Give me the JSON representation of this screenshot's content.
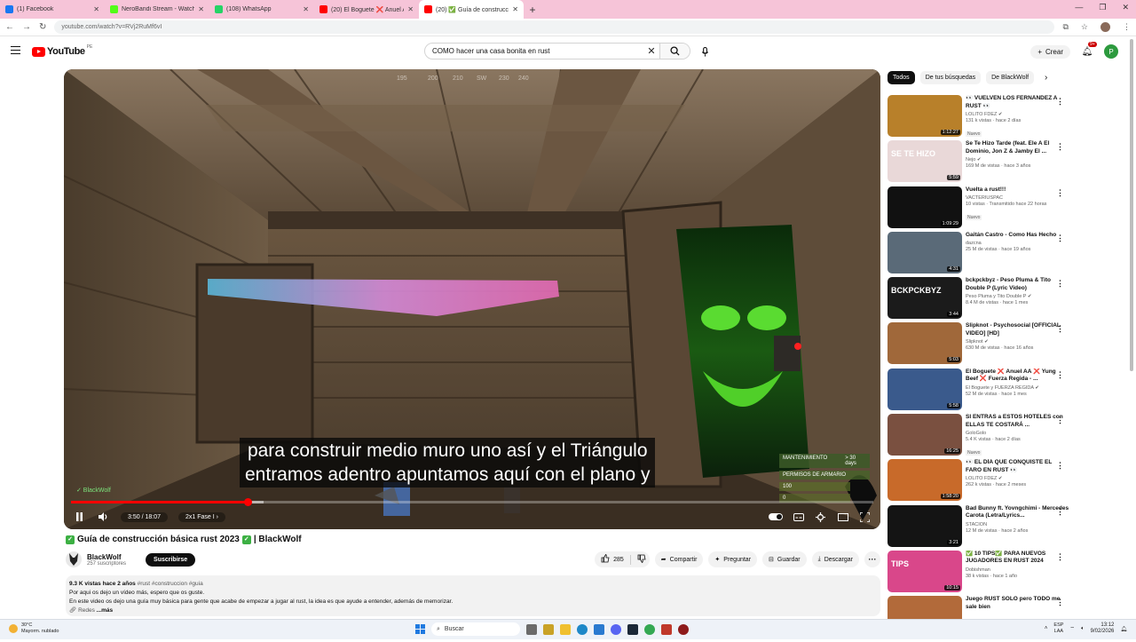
{
  "browser": {
    "tabs": [
      {
        "title": "(1) Facebook",
        "color": "#1877f2",
        "active": false
      },
      {
        "title": "NeroBandi Stream - Watch Live",
        "color": "#53fc18",
        "active": false
      },
      {
        "title": "(108) WhatsApp",
        "color": "#25d366",
        "active": false
      },
      {
        "title": "(20) El Boguete ❌ Anuel AA ❌",
        "color": "#ff0000",
        "active": false
      },
      {
        "title": "(20) ✅ Guía de construcción",
        "color": "#ff0000",
        "active": true
      }
    ],
    "new_tab": "+",
    "url": "youtube.com/watch?v=RVj2RuMf6vI"
  },
  "header": {
    "logo_text": "YouTube",
    "country_code": "PE",
    "search_query": "COMO hacer una casa bonita en rust",
    "create_label": "Crear",
    "notif_count": "9+",
    "user_initial": "P"
  },
  "player": {
    "subtitle_line1": "para construir medio muro uno así y el Triángulo",
    "subtitle_line2": "entramos adentro apuntamos aquí con el plano y",
    "time": "3:50 / 18:07",
    "chapter": "2x1 Fase I",
    "watermark": "✓ BlackWolf",
    "progress_played_fraction": 0.22,
    "progress_buffered_fraction": 0.24,
    "hud": {
      "row1_label": "MANTENIMIENTO",
      "row1_value": "> 30 days",
      "row2_label": "PERMISOS DE ARMARIO",
      "row3_value": "100",
      "row4_value": "0"
    }
  },
  "video": {
    "title": "Guía de construcción básica rust 2023",
    "title_suffix": "| BlackWolf",
    "channel_name": "BlackWolf",
    "subscribers": "257 suscriptores",
    "subscribe_label": "Suscribirse",
    "likes": "285",
    "share_label": "Compartir",
    "ask_label": "Preguntar",
    "save_label": "Guardar",
    "download_label": "Descargar",
    "views_date": "9.3 K vistas  hace 2 años",
    "tags": "#rust #construccion #guia",
    "desc_line1": "Por aqui os dejo un vídeo más, espero que os guste.",
    "desc_line2": "En este video os dejo una guía muy básica para gente que acabe de empezar a jugar al rust, la idea es que ayude a entender, además de memorizar.",
    "desc_line3": "Redes",
    "more_label": "...más"
  },
  "sidebar": {
    "chips": [
      "Todos",
      "De tus búsquedas",
      "De BlackWolf"
    ],
    "recommendations": [
      {
        "title": "👀 VUELVEN LOS FERNÁNDEZ A RUST 👀",
        "channel": "LOLITO FDEZ",
        "meta": "131 k vistas · hace 2 días",
        "badge": "Nuevo",
        "duration": "1:12:27",
        "thumb_bg": "#b8802a",
        "thumb_text": "",
        "verified": true
      },
      {
        "title": "Se Te Hizo Tarde (feat. Ele A El Dominio, Jon Z & Jamby El ...",
        "channel": "Nejo",
        "meta": "169 M de vistas · hace 3 años",
        "badge": "",
        "duration": "5:59",
        "thumb_bg": "#e9d8d8",
        "thumb_text": "SE TE HIZO",
        "verified": true
      },
      {
        "title": "Vuelta a rust!!!",
        "channel": "VACTERIUSPAC",
        "meta": "10 vistas · Transmitido hace 22 horas",
        "badge": "Nuevo",
        "duration": "1:09:29",
        "thumb_bg": "#111111",
        "thumb_text": "",
        "verified": false
      },
      {
        "title": "Gaitán Castro - Como Has Hecho",
        "channel": "dazcna",
        "meta": "25 M de vistas · hace 19 años",
        "badge": "",
        "duration": "4:31",
        "thumb_bg": "#5a6a78",
        "thumb_text": "",
        "verified": false
      },
      {
        "title": "bckpckbyz - Peso Pluma & Tito Double P (Lyric Video)",
        "channel": "Peso Pluma y Tito Double P",
        "meta": "8.4 M de vistas · hace 1 mes",
        "badge": "",
        "duration": "3:44",
        "thumb_bg": "#1b1b1b",
        "thumb_text": "BCKPCKBYZ",
        "verified": true
      },
      {
        "title": "Slipknot - Psychosocial [OFFICIAL VIDEO] [HD]",
        "channel": "Slipknot",
        "meta": "630 M de vistas · hace 16 años",
        "badge": "",
        "duration": "5:03",
        "thumb_bg": "#a0683a",
        "thumb_text": "",
        "verified": true
      },
      {
        "title": "El Boguete ❌ Anuel AA ❌ Yung Beef ❌ Fuerza Regida - ...",
        "channel": "El Boguete y FUERZA REGIDA",
        "meta": "52 M de vistas · hace 1 mes",
        "badge": "",
        "duration": "5:58",
        "thumb_bg": "#3a5a8c",
        "thumb_text": "",
        "verified": true
      },
      {
        "title": "SI ENTRAS a ESTOS HOTELES con ELLAS TE COSTARÁ ...",
        "channel": "GoloGolo",
        "meta": "5.4 K vistas · hace 2 días",
        "badge": "Nuevo",
        "duration": "16:25",
        "thumb_bg": "#7a5040",
        "thumb_text": "",
        "verified": false
      },
      {
        "title": "👀 EL DÍA QUE CONQUISTÉ EL FARO EN RUST 👀",
        "channel": "LOLITO FDEZ",
        "meta": "262 k vistas · hace 2 meses",
        "badge": "",
        "duration": "1:58:20",
        "thumb_bg": "#c86a2a",
        "thumb_text": "",
        "verified": true
      },
      {
        "title": "Bad Bunny ft. Yovngchimi - Mercedes Carota (Letra/Lyrics...",
        "channel": "STACION",
        "meta": "12 M de vistas · hace 2 años",
        "badge": "",
        "duration": "3:21",
        "thumb_bg": "#141414",
        "thumb_text": "",
        "verified": false
      },
      {
        "title": "✅ 10 TIPS✅ PARA NUEVOS JUGADORES EN RUST 2024",
        "channel": "Dobishman",
        "meta": "38 k vistas · hace 1 año",
        "badge": "",
        "duration": "10:15",
        "thumb_bg": "#d9478a",
        "thumb_text": "TIPS",
        "verified": false
      },
      {
        "title": "Juego RUST SOLO pero TODO me sale bien",
        "channel": "",
        "meta": "",
        "badge": "",
        "duration": "",
        "thumb_bg": "#b26a3a",
        "thumb_text": "",
        "verified": false
      }
    ]
  },
  "taskbar": {
    "temp": "30°C",
    "weather": "Mayorm. nublado",
    "search_label": "Buscar",
    "lang_line1": "ESP",
    "lang_line2": "LAA",
    "time": "13:12",
    "date": "9/02/2026"
  }
}
